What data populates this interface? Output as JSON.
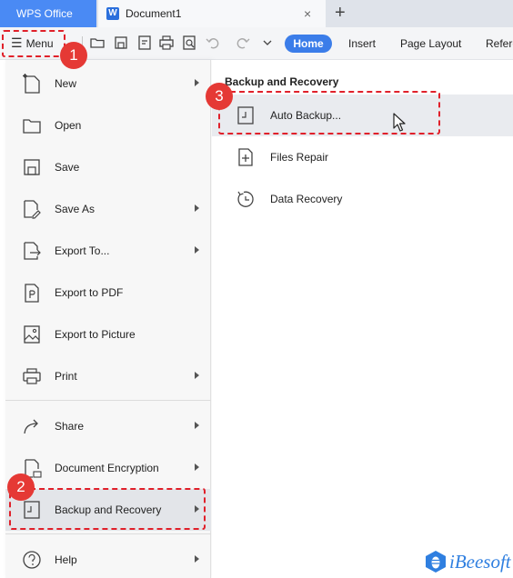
{
  "titlebar": {
    "app_tab": "WPS Office",
    "doc_tab": "Document1",
    "doc_tab_icon": "W",
    "close_glyph": "×",
    "new_tab_glyph": "+"
  },
  "toolbar": {
    "menu_label": "Menu",
    "ribbon_tabs": [
      "Home",
      "Insert",
      "Page Layout",
      "Refere"
    ],
    "active_tab": "Home"
  },
  "menu": {
    "items": [
      {
        "label": "New",
        "icon": "new-file-icon",
        "has_submenu": true
      },
      {
        "label": "Open",
        "icon": "folder-open-icon",
        "has_submenu": false
      },
      {
        "label": "Save",
        "icon": "save-icon",
        "has_submenu": false
      },
      {
        "label": "Save As",
        "icon": "save-as-icon",
        "has_submenu": true
      },
      {
        "label": "Export To...",
        "icon": "export-icon",
        "has_submenu": true
      },
      {
        "label": "Export to PDF",
        "icon": "pdf-icon",
        "has_submenu": false
      },
      {
        "label": "Export to Picture",
        "icon": "picture-icon",
        "has_submenu": false
      },
      {
        "label": "Print",
        "icon": "printer-icon",
        "has_submenu": true
      },
      {
        "label": "Share",
        "icon": "share-icon",
        "has_submenu": true
      },
      {
        "label": "Document Encryption",
        "icon": "encryption-icon",
        "has_submenu": true
      },
      {
        "label": "Backup and Recovery",
        "icon": "backup-icon",
        "has_submenu": true,
        "highlighted": true
      },
      {
        "label": "Help",
        "icon": "help-icon",
        "has_submenu": true
      }
    ]
  },
  "submenu": {
    "title": "Backup and Recovery",
    "items": [
      {
        "label": "Auto Backup...",
        "icon": "auto-backup-icon",
        "highlighted": true
      },
      {
        "label": "Files Repair",
        "icon": "files-repair-icon"
      },
      {
        "label": "Data Recovery",
        "icon": "data-recovery-icon"
      }
    ]
  },
  "annotations": {
    "step1": "1",
    "step2": "2",
    "step3": "3",
    "color": "#e0202a"
  },
  "brand": {
    "text": "iBeesoft",
    "color": "#2f7fe0"
  },
  "colors": {
    "accent": "#3b7de9",
    "app_tab_bg": "#4a8af4",
    "highlight": "#e3e5e9"
  }
}
